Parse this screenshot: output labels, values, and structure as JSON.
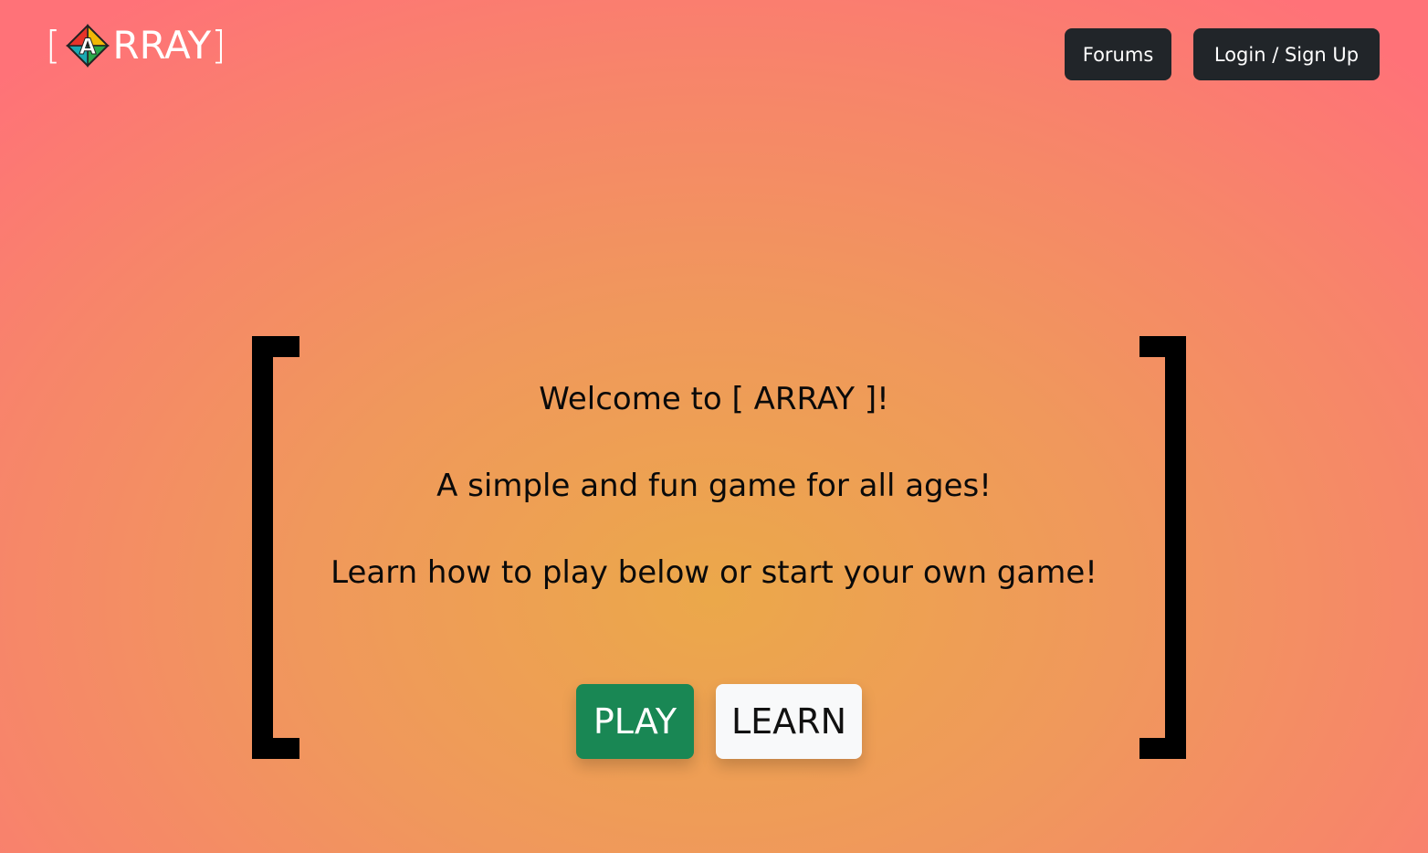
{
  "logo": {
    "open_bracket": "[",
    "mark_letter": "A",
    "rest": "RRAY",
    "close_bracket": "]",
    "mark_colors": [
      "#f2b705",
      "#2aa84a",
      "#e8332a",
      "#1aa9b3"
    ]
  },
  "nav": {
    "forums_label": "Forums",
    "login_label": "Login / Sign Up"
  },
  "hero": {
    "line1": "Welcome to [ ARRAY ]!",
    "line2": "A simple and fun game for all ages!",
    "line3": "Learn how to play below or start your own game!"
  },
  "actions": {
    "play_label": "PLAY",
    "learn_label": "LEARN"
  },
  "colors": {
    "play": "#198754",
    "learn": "#f8f9fa",
    "nav": "#212529"
  }
}
